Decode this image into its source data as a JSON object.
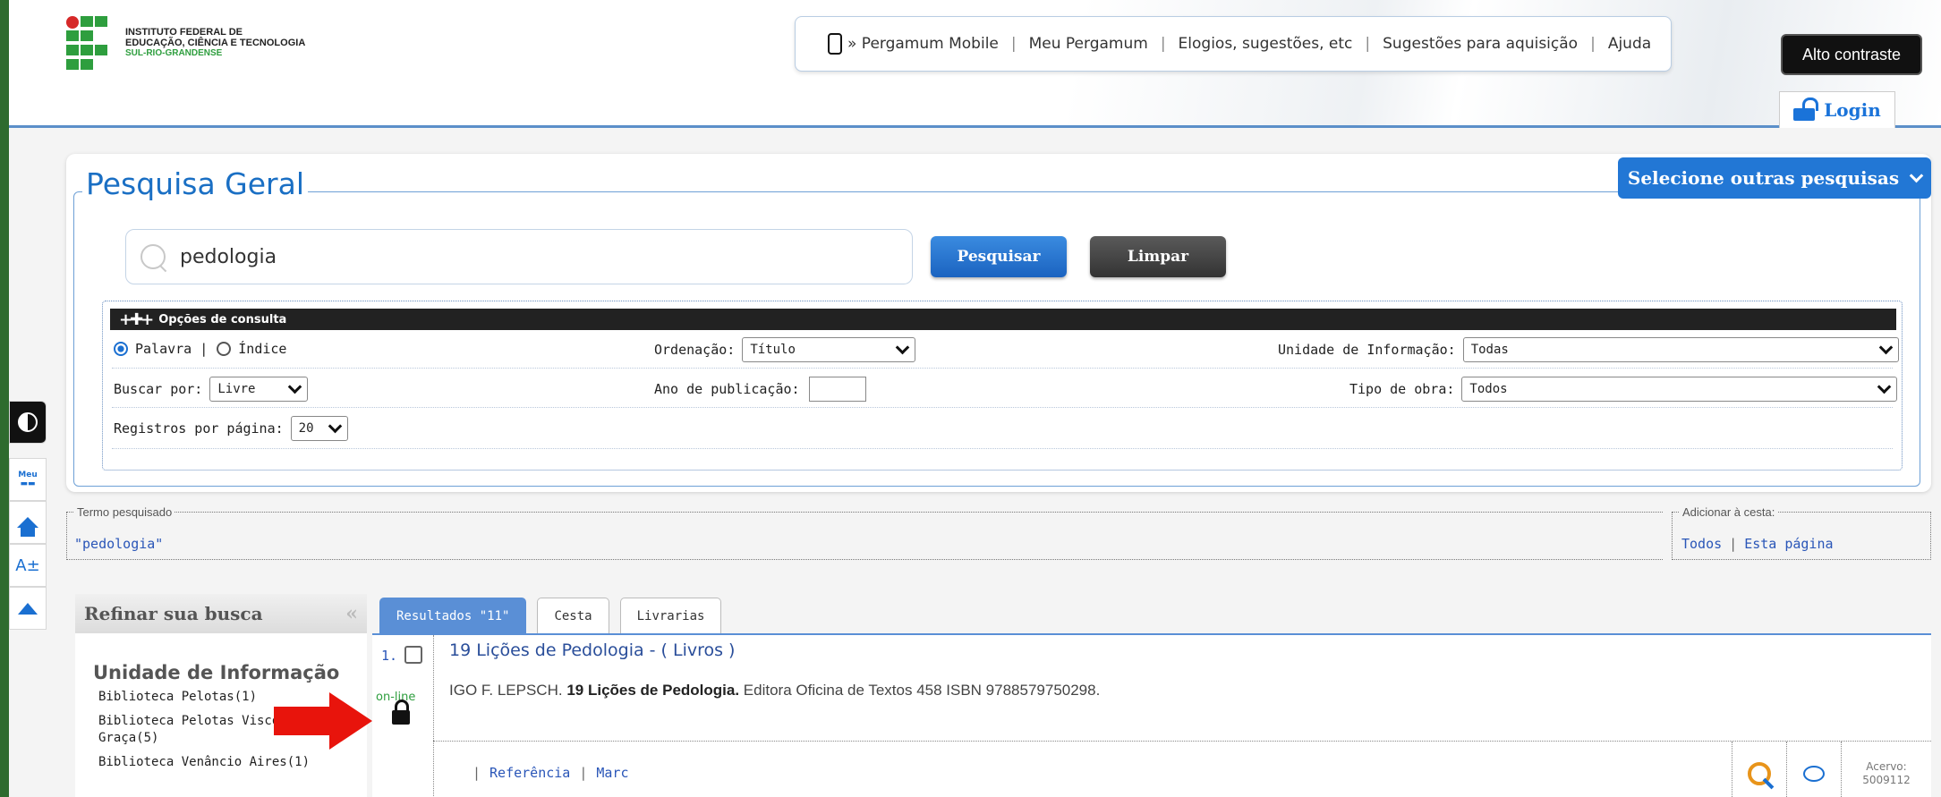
{
  "header": {
    "institute_line1": "INSTITUTO FEDERAL DE",
    "institute_line2": "EDUCAÇÃO, CIÊNCIA E TECNOLOGIA",
    "institute_line3": "SUL-RIO-GRANDENSE",
    "nav": [
      "» Pergamum Mobile",
      "Meu Pergamum",
      "Elogios, sugestões, etc",
      "Sugestões para aquisição",
      "Ajuda"
    ],
    "contrast_button": "Alto contraste",
    "login": "Login"
  },
  "sidebar": {
    "meu_label": "Meu",
    "font_label": "A±"
  },
  "search": {
    "title": "Pesquisa Geral",
    "select_other": "Selecione outras pesquisas",
    "query": "pedologia",
    "btn_search": "Pesquisar",
    "btn_clear": "Limpar",
    "options_title": "Opções de consulta",
    "radio_word": "Palavra |",
    "radio_index": "Índice",
    "order_label": "Ordenação:",
    "order_value": "Título",
    "unit_label": "Unidade de Informação:",
    "unit_value": "Todas",
    "search_by_label": "Buscar por:",
    "search_by_value": "Livre",
    "year_label": "Ano de publicação:",
    "work_type_label": "Tipo de obra:",
    "work_type_value": "Todos",
    "per_page_label": "Registros por página:",
    "per_page_value": "20"
  },
  "term": {
    "label": "Termo pesquisado",
    "value": "\"pedologia\""
  },
  "cart": {
    "label": "Adicionar à cesta:",
    "all": "Todos",
    "page": "Esta página"
  },
  "refine": {
    "title": "Refinar sua busca",
    "collapse": "«",
    "group_title": "Unidade de Informação",
    "items": [
      "Biblioteca Pelotas(1)",
      "Biblioteca Pelotas Visconde da Graça(5)",
      "Biblioteca Venâncio Aires(1)"
    ]
  },
  "tabs": [
    "Resultados \"11\"",
    "Cesta",
    "Livrarias"
  ],
  "result": {
    "number": "1.",
    "title": "19 Lições de Pedologia - ( Livros )",
    "author": "IGO F. LEPSCH.",
    "book": "19 Lições de Pedologia.",
    "rest": "Editora Oficina de Textos 458 ISBN 9788579750298.",
    "online": "on-line",
    "link_ref": "Referência",
    "link_marc": "Marc",
    "acervo_label": "Acervo:",
    "acervo_value": "5009112"
  },
  "colors": {
    "accent": "#2277d5",
    "frame": "#2e6b2e",
    "arrow": "#e8140c"
  }
}
